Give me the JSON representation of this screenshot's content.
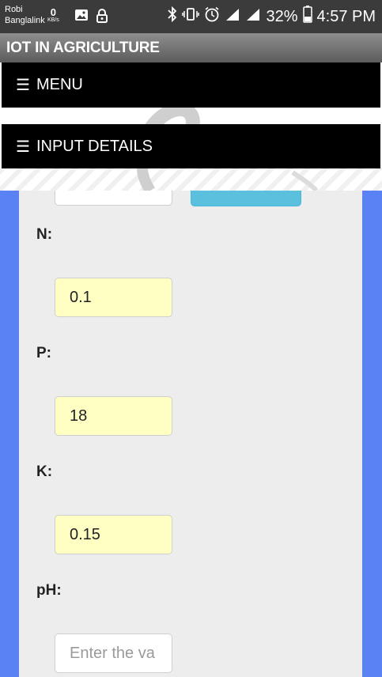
{
  "status": {
    "carrier1": "Robi",
    "carrier2": "Banglalink",
    "speed_value": "0",
    "speed_unit": "KB/s",
    "battery": "32%",
    "time": "4:57 PM"
  },
  "app": {
    "title": "IOT IN AGRICULTURE"
  },
  "nav": {
    "menu_label": "MENU",
    "input_details_label": "INPUT DETAILS"
  },
  "form": {
    "fields": [
      {
        "label": "N:",
        "value": "0.1"
      },
      {
        "label": "P:",
        "value": "18"
      },
      {
        "label": "K:",
        "value": "0.15"
      },
      {
        "label": "pH:",
        "value": "",
        "placeholder": "Enter the va"
      }
    ]
  },
  "colors": {
    "accent_button": "#5bc0de",
    "field_bg": "#ffffc4",
    "page_bg": "#5a82f5"
  }
}
